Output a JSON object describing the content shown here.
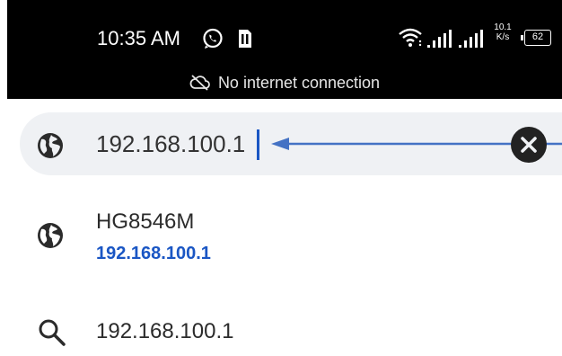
{
  "status_bar": {
    "time": "10:35 AM",
    "net_speed_value": "10.1",
    "net_speed_unit": "K/s",
    "battery_level": "62",
    "notice": "No internet connection"
  },
  "search": {
    "value": "192.168.100.1"
  },
  "suggestions": [
    {
      "icon": "globe-icon",
      "title": "HG8546M",
      "url": "192.168.100.1"
    },
    {
      "icon": "search-icon",
      "query": "192.168.100.1"
    }
  ],
  "colors": {
    "link": "#1a56c4",
    "caret": "#1a56c4",
    "search_bg": "#eff1f4",
    "status_bg": "#000000"
  }
}
